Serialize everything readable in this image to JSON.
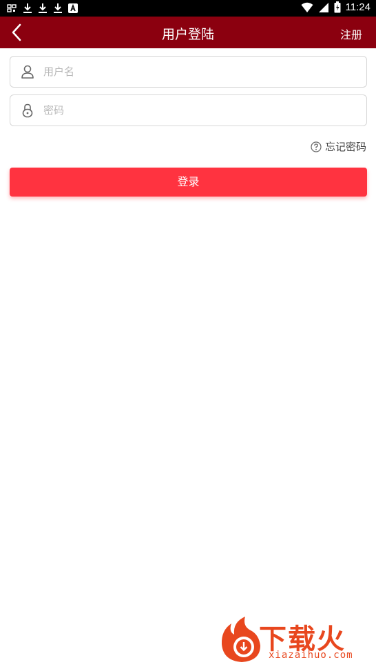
{
  "status_bar": {
    "time": "11:24",
    "left_icons": [
      "qr-icon",
      "download-icon",
      "download-icon",
      "download-icon",
      "a-icon"
    ],
    "right_icons": [
      "wifi-icon",
      "signal-icon",
      "battery-icon"
    ]
  },
  "app_bar": {
    "title": "用户登陆",
    "register_label": "注册",
    "back_icon": "chevron-left-icon",
    "background": "#8b000f"
  },
  "form": {
    "username": {
      "placeholder": "用户名",
      "value": "",
      "icon": "user-icon"
    },
    "password": {
      "placeholder": "密码",
      "value": "",
      "icon": "lock-icon"
    },
    "forgot_label": "忘记密码",
    "login_label": "登录",
    "login_color": "#ff3340"
  },
  "watermark": {
    "brand": "下载火",
    "domain": "xiazaihuo.com"
  }
}
